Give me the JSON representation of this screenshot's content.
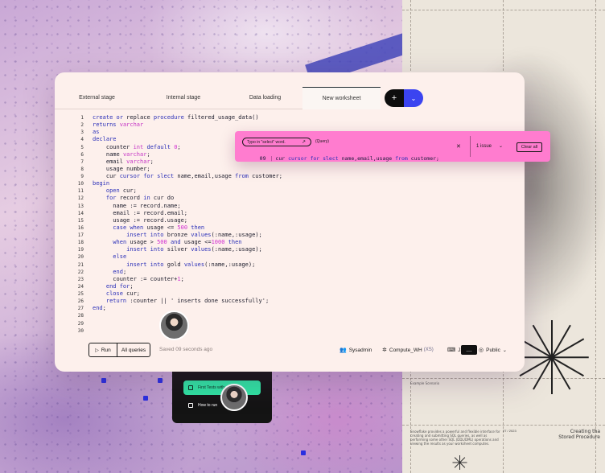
{
  "tabs": [
    {
      "label": "External stage"
    },
    {
      "label": "Internal stage"
    },
    {
      "label": "Data loading"
    },
    {
      "label": "New worksheet"
    }
  ],
  "tab_add": {
    "plus_glyph": "+",
    "chevron_glyph": "⌄"
  },
  "code": {
    "lines": [
      {
        "n": "1",
        "html": "<span class='kw'>create or</span> replace <span class='kw'>procedure</span> filtered_usage_data()"
      },
      {
        "n": "2",
        "html": "<span class='kw'>returns</span> <span class='ty'>varchar</span>"
      },
      {
        "n": "3",
        "html": "<span class='kw'>as</span>"
      },
      {
        "n": "4",
        "html": "<span class='kw'>declare</span>"
      },
      {
        "n": "5",
        "html": "    counter <span class='ty'>int</span> <span class='kw'>default</span> <span class='nu'>0</span>;"
      },
      {
        "n": "6",
        "html": "    name <span class='ty'>varchar</span>;"
      },
      {
        "n": "7",
        "html": "    email <span class='ty'>varchar</span>;"
      },
      {
        "n": "8",
        "html": "    usage number;"
      },
      {
        "n": "9",
        "html": "    cur <span class='kw'>cursor for slect</span> name,email,usage <span class='kw'>from</span> customer;"
      },
      {
        "n": "10",
        "html": "<span class='kw'>begin</span>"
      },
      {
        "n": "11",
        "html": "    <span class='kw'>open</span> cur;"
      },
      {
        "n": "12",
        "html": "    <span class='kw'>for</span> record <span class='kw'>in</span> cur do"
      },
      {
        "n": "13",
        "html": "      name := record.name;"
      },
      {
        "n": "14",
        "html": "      email := record.email;"
      },
      {
        "n": "15",
        "html": "      usage := record.usage;"
      },
      {
        "n": "16",
        "html": "      <span class='kw'>case when</span> usage &lt;= <span class='nu'>500</span> <span class='kw'>then</span>"
      },
      {
        "n": "17",
        "html": "          <span class='kw'>insert into</span> bronze <span class='kw'>values</span>(:name,:usage);"
      },
      {
        "n": "18",
        "html": "      <span class='kw'>when</span> usage &gt; <span class='nu'>500</span> <span class='kw'>and</span> usage &lt;=<span class='nu'>1000</span> <span class='kw'>then</span>"
      },
      {
        "n": "19",
        "html": "          <span class='kw'>insert into</span> silver <span class='kw'>values</span>(:name,:usage);"
      },
      {
        "n": "20",
        "html": "      <span class='kw'>else</span>"
      },
      {
        "n": "21",
        "html": "          <span class='kw'>insert into</span> gold <span class='kw'>values</span>(:name,:usage);"
      },
      {
        "n": "22",
        "html": "      <span class='kw'>end</span>;"
      },
      {
        "n": "23",
        "html": "      counter := counter+<span class='nu'>1</span>;"
      },
      {
        "n": "24",
        "html": "    <span class='kw'>end for</span>;"
      },
      {
        "n": "25",
        "html": "    <span class='kw'>close</span> cur;"
      },
      {
        "n": "26",
        "html": "    <span class='kw'>return</span> :counter || ' inserts done successfully';"
      },
      {
        "n": "27",
        "html": "<span class='kw'>end</span>;"
      },
      {
        "n": "28",
        "html": ""
      },
      {
        "n": "29",
        "html": ""
      },
      {
        "n": "30",
        "html": ""
      }
    ]
  },
  "toolbar": {
    "run_label": "Run",
    "run_glyph": "▷",
    "all_queries_label": "All queries",
    "saved_text": "Saved 09 seconds ago",
    "user_label": "Sysadmin",
    "warehouse_label": "Compute_WH",
    "warehouse_size": "(XS)",
    "format_label": "JSON",
    "visibility_label": "Public",
    "more_glyph": "..."
  },
  "error_popup": {
    "message": "Typo in \"select\" word.",
    "tag": "(Query)",
    "line_number": "09",
    "code_html": "cur <span class='kw'>cursor for slect</span> name,email,usage <span class='kw'>from</span> customer;",
    "close_glyph": "✕",
    "issues_label": "1 issue",
    "clear_label": "Clear all"
  },
  "mini_panel": {
    "item_active": "First Tests with",
    "item_plain": "How to run"
  },
  "paper": {
    "heading": "Creating tha\nStored Procedure",
    "date": "27 / 2023",
    "para1": "Snowflake provides a powerful and flexible interface for creating and submitting SQL queries, as well as performing some other SQL (DDL/DML) operations and viewing the results as your worksheet computes.",
    "para2": "Example Scenario"
  },
  "colors": {
    "accent_blue": "#3b44f0",
    "error_pink": "#ff7ccf",
    "success_green": "#2fe3a2",
    "card_bg": "#fdf0ec"
  }
}
